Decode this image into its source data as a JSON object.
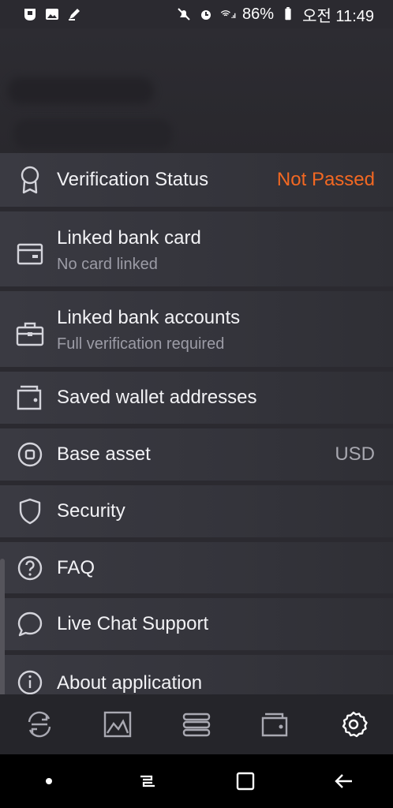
{
  "status_bar": {
    "battery": "86%",
    "time": "오전 11:49"
  },
  "menu": {
    "verification": {
      "label": "Verification Status",
      "value": "Not Passed"
    },
    "bank_card": {
      "label": "Linked bank card",
      "subtitle": "No card linked"
    },
    "bank_accounts": {
      "label": "Linked bank accounts",
      "subtitle": "Full verification required"
    },
    "wallets": {
      "label": "Saved wallet addresses"
    },
    "base_asset": {
      "label": "Base asset",
      "value": "USD"
    },
    "security": {
      "label": "Security"
    },
    "faq": {
      "label": "FAQ"
    },
    "chat": {
      "label": "Live Chat Support"
    },
    "about": {
      "label": "About application"
    }
  },
  "colors": {
    "accent": "#f26822",
    "background": "#2b2a30"
  },
  "icons": [
    "badge-icon",
    "card-icon",
    "briefcase-icon",
    "wallet-icon",
    "target-icon",
    "shield-icon",
    "help-icon",
    "chat-icon",
    "info-icon",
    "refresh-icon",
    "chart-icon",
    "stack-icon",
    "wallet-nav-icon",
    "gear-icon"
  ]
}
